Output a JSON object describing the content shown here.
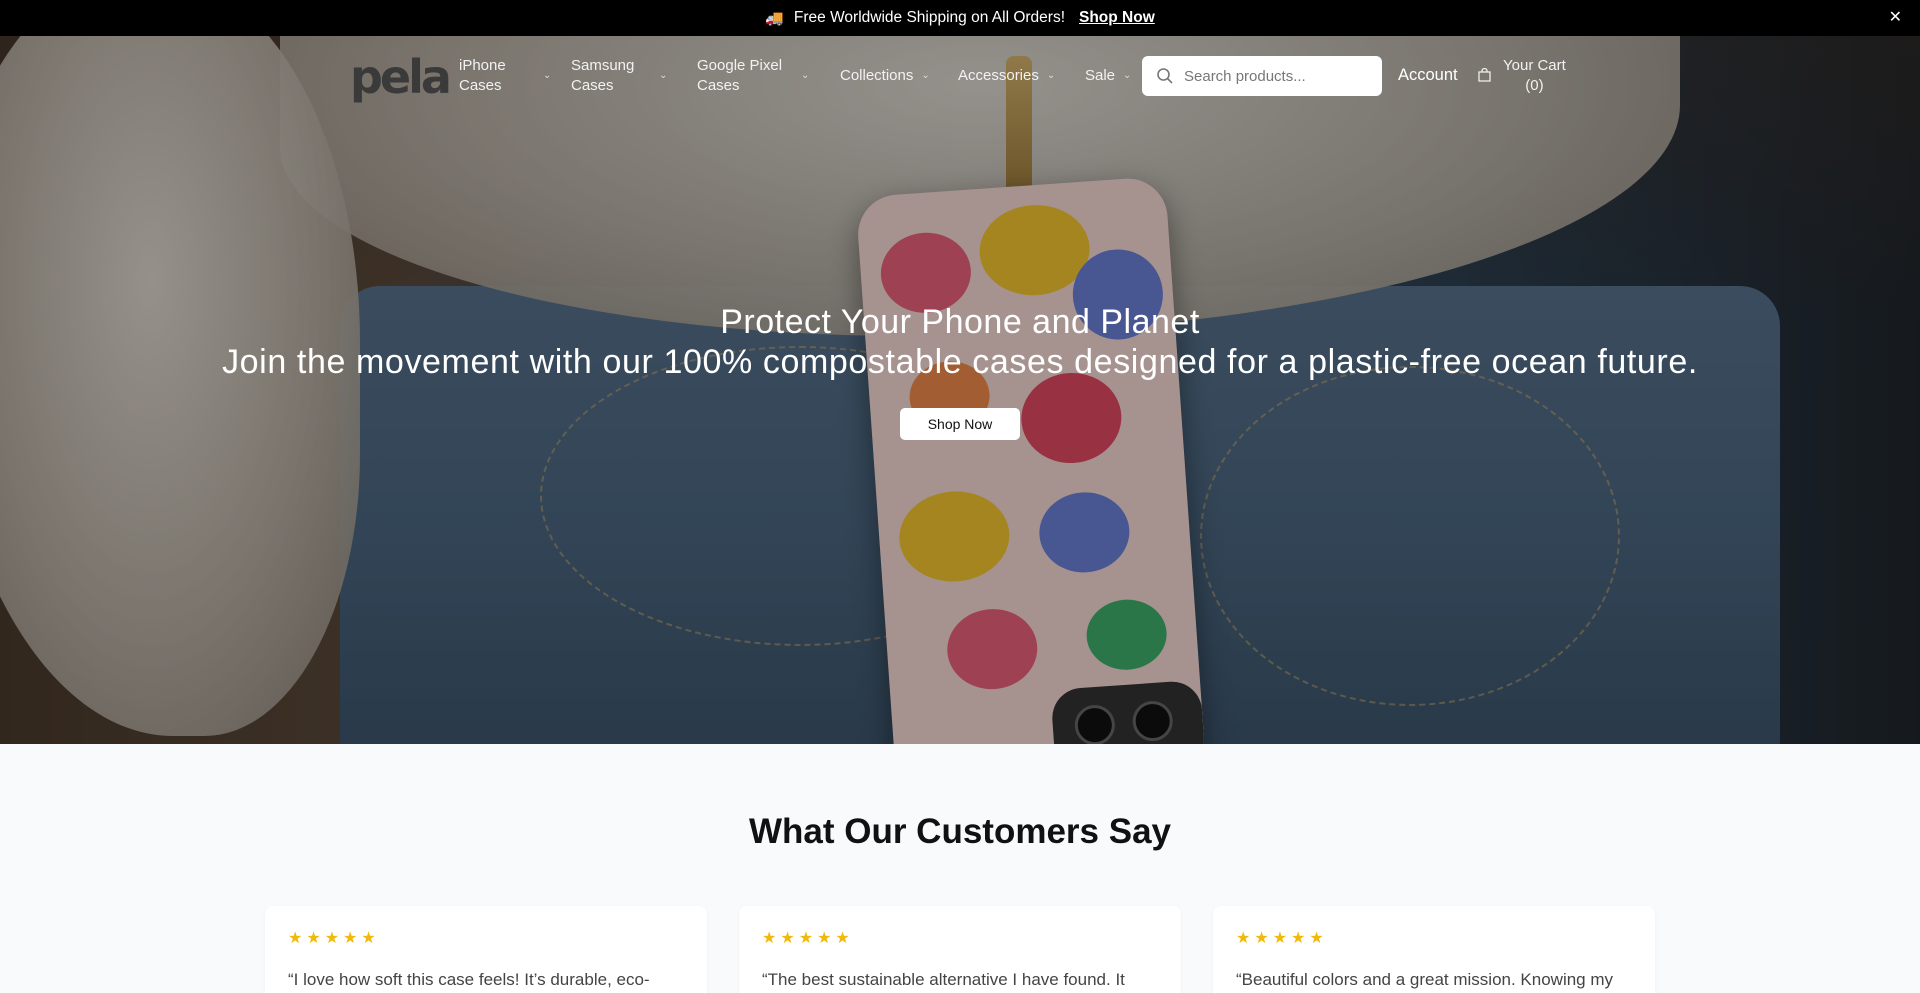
{
  "announcement": {
    "icon": "truck-icon",
    "text": "Free Worldwide Shipping on All Orders!",
    "link": "Shop Now",
    "close": "✕"
  },
  "header": {
    "logo": "pela",
    "nav": [
      {
        "label": "iPhone Cases"
      },
      {
        "label": "Samsung Cases"
      },
      {
        "label": "Google Pixel Cases"
      },
      {
        "label": "Collections"
      },
      {
        "label": "Accessories"
      },
      {
        "label": "Sale"
      }
    ],
    "search_placeholder": "Search products...",
    "account": "Account",
    "cart_label": "Your Cart",
    "cart_count": "(0)"
  },
  "hero": {
    "title": "Protect Your Phone and Planet",
    "subtitle": "Join the movement with our 100% compostable cases designed for a plastic-free ocean future.",
    "cta": "Shop Now"
  },
  "testimonials": {
    "title": "What Our Customers Say",
    "items": [
      {
        "stars": "★★★★★",
        "rating": 5,
        "quote": "“I love how soft this case feels! It’s durable, eco-"
      },
      {
        "stars": "★★★★★",
        "rating": 5,
        "quote": "“The best sustainable alternative I have found. It"
      },
      {
        "stars": "★★★★★",
        "rating": 5,
        "quote": "“Beautiful colors and a great mission. Knowing my"
      }
    ]
  },
  "colors": {
    "announcement_bg": "#000000",
    "star": "#f0b90b",
    "section_bg": "#f8fafc"
  }
}
